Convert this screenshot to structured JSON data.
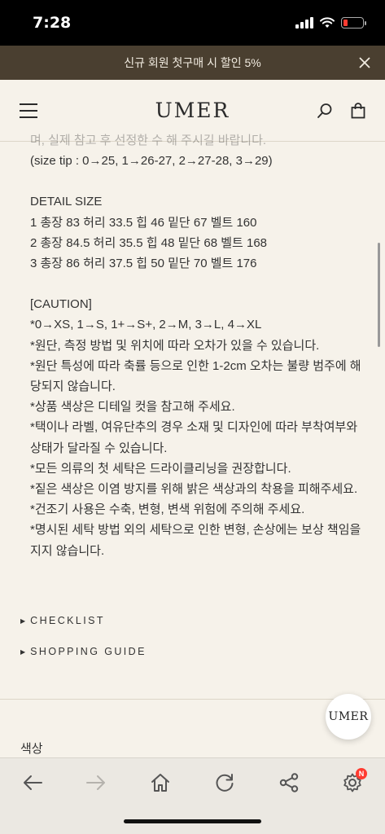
{
  "status_bar": {
    "time": "7:28"
  },
  "promo": {
    "text": "신규 회원 첫구매 시 할인 5%"
  },
  "header": {
    "logo": "UMER"
  },
  "content": {
    "cut_line": "며, 실제 참고 후 선정한 수 해 주시길 바랍니다.",
    "size_tip": "(size tip : 0→25, 1→26-27, 2→27-28, 3→29)",
    "detail_title": "DETAIL SIZE",
    "detail_lines": [
      "1 총장 83 허리 33.5 힙 46 밑단 67 벨트 160",
      "2 총장 84.5 허리 35.5 힙 48 밑단 68 벨트 168",
      "3 총장 86 허리 37.5 힙 50 밑단 70 벨트 176"
    ],
    "caution_title": "[CAUTION]",
    "caution_lines": [
      "*0→XS, 1→S, 1+→S+, 2→M, 3→L, 4→XL",
      "*원단, 측정 방법 및 위치에 따라 오차가 있을 수 있습니다.",
      "*원단 특성에 따라 축률 등으로 인한 1-2cm 오차는 불량 범주에 해당되지 않습니다.",
      "*상품 색상은 디테일 컷을 참고해 주세요.",
      "*택이나 라벨, 여유단추의 경우 소재 및 디자인에 따라 부착여부와 상태가 달라질 수 있습니다.",
      "*모든 의류의 첫 세탁은 드라이클리닝을 권장합니다.",
      "*짙은 색상은 이염 방지를 위해 밝은 색상과의 착용을 피해주세요.",
      "*건조기 사용은 수축, 변형, 변색 위험에 주의해 주세요.",
      "*명시된 세탁 방법 외의 세탁으로 인한 변형, 손상에는 보상 책임을 지지 않습니다."
    ]
  },
  "links": {
    "checklist": "CHECKLIST",
    "shopping_guide": "SHOPPING GUIDE"
  },
  "color_label": "색상",
  "fab": {
    "label": "UMER"
  },
  "browser_bar": {
    "settings_badge": "N"
  }
}
